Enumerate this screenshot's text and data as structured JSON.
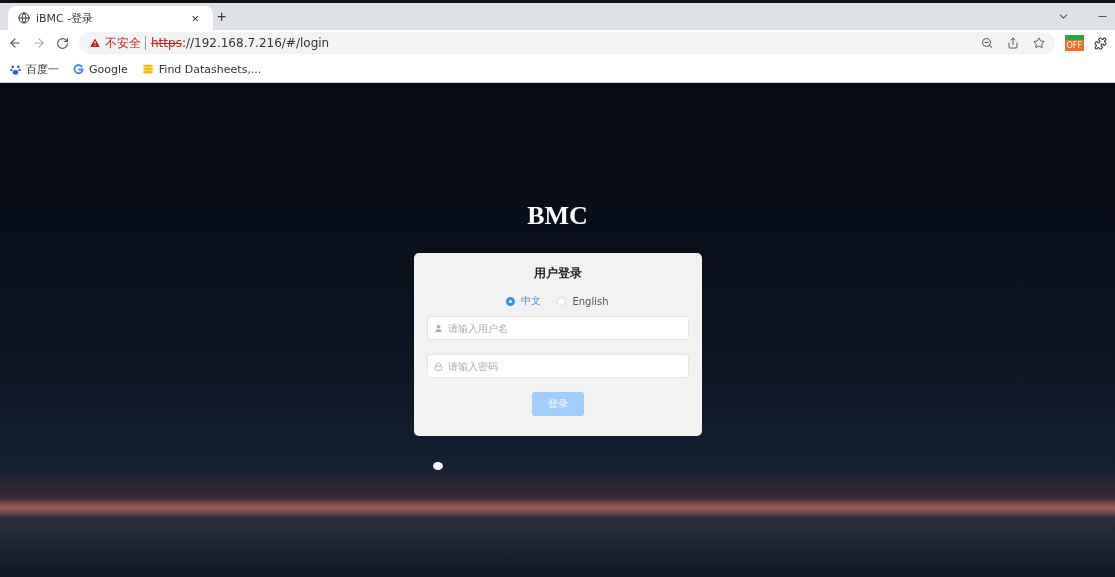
{
  "browser": {
    "tab": {
      "title": "iBMC -登录",
      "close": "×",
      "selected": true
    },
    "new_tab": "+",
    "security": "不安全",
    "url_scheme": "https",
    "url_rest": "://192.168.7.216/#/login",
    "extension_badge": "OFF",
    "bookmarks": [
      {
        "label": "百度一"
      },
      {
        "label": "Google"
      },
      {
        "label": "Find Datasheets,..."
      }
    ]
  },
  "page": {
    "logo": "BMC",
    "login": {
      "title": "用户登录",
      "languages": [
        {
          "label": "中文",
          "selected": true
        },
        {
          "label": "English",
          "selected": false
        }
      ],
      "fields": [
        {
          "kind": "user",
          "placeholder": "请输入用户名"
        },
        {
          "kind": "password",
          "placeholder": "请输入密码"
        }
      ],
      "submit": {
        "label": "登录",
        "disabled": true
      }
    }
  }
}
